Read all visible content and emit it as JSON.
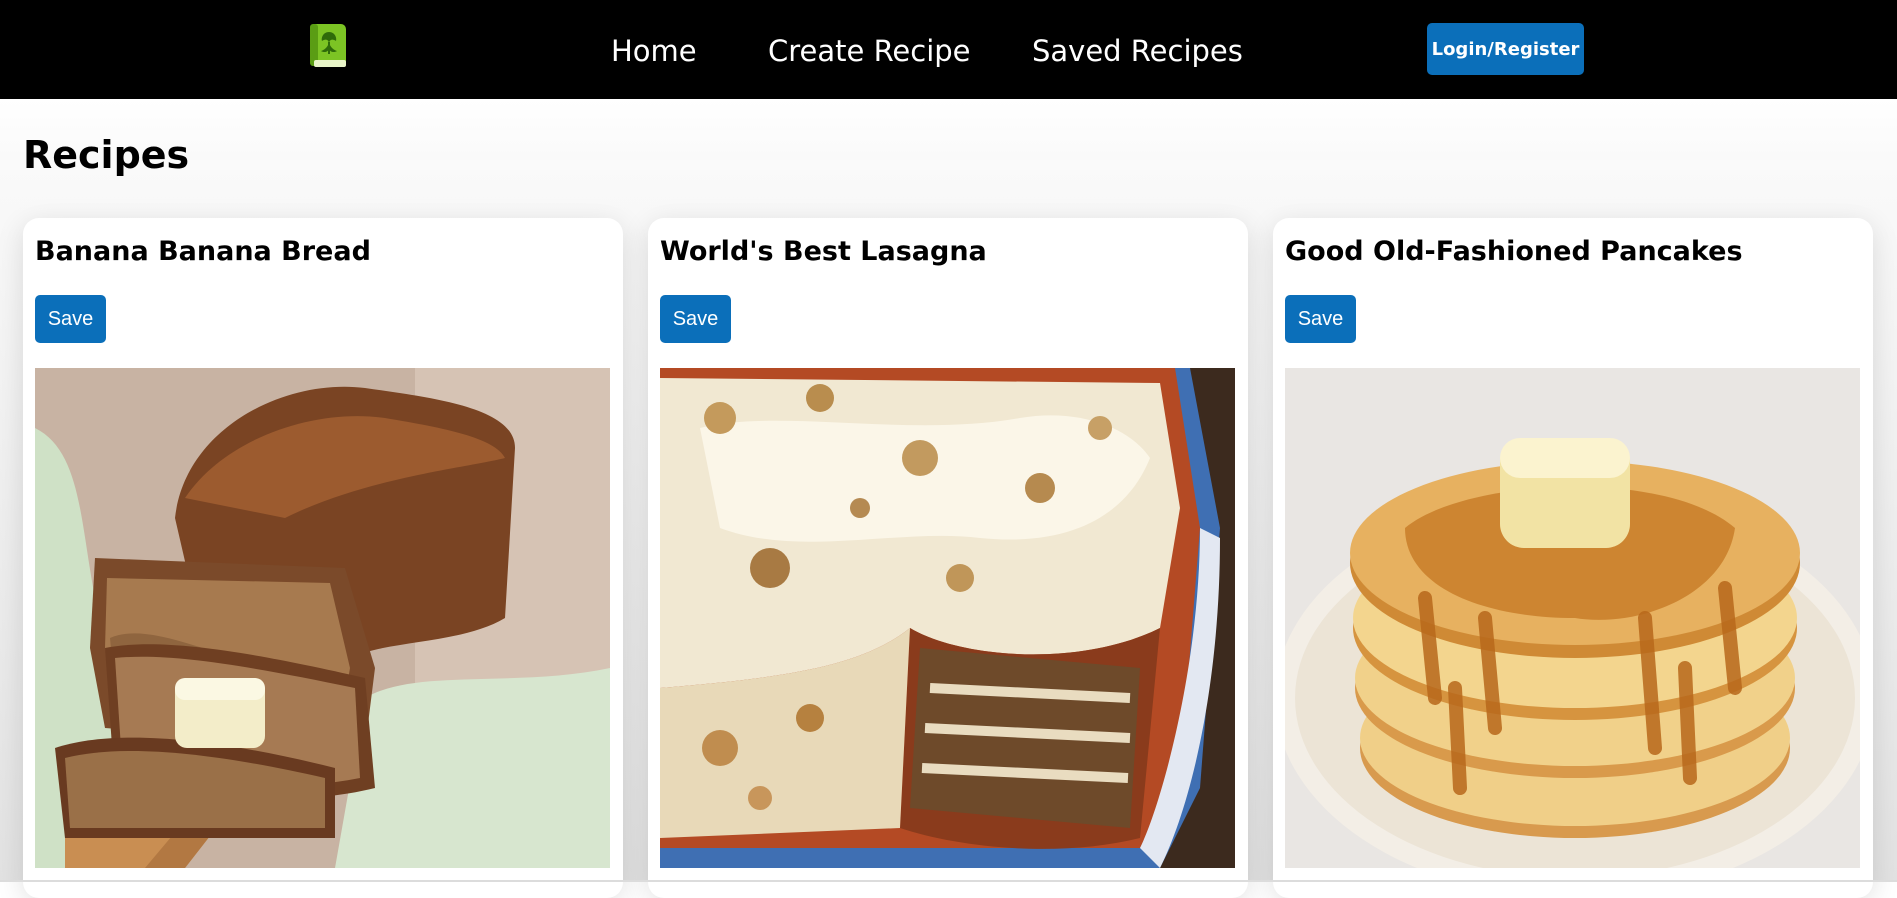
{
  "navbar": {
    "logo_icon": "recipe-book-icon",
    "links": [
      {
        "label": "Home"
      },
      {
        "label": "Create Recipe"
      },
      {
        "label": "Saved Recipes"
      }
    ],
    "login_label": "Login/Register",
    "accent_color": "#0b6fba"
  },
  "main": {
    "title": "Recipes",
    "recipes": [
      {
        "name": "Banana Banana Bread",
        "save_label": "Save",
        "image_icon": "banana-bread-photo"
      },
      {
        "name": "World's Best Lasagna",
        "save_label": "Save",
        "image_icon": "lasagna-photo"
      },
      {
        "name": "Good Old-Fashioned Pancakes",
        "save_label": "Save",
        "image_icon": "pancakes-photo"
      }
    ]
  }
}
